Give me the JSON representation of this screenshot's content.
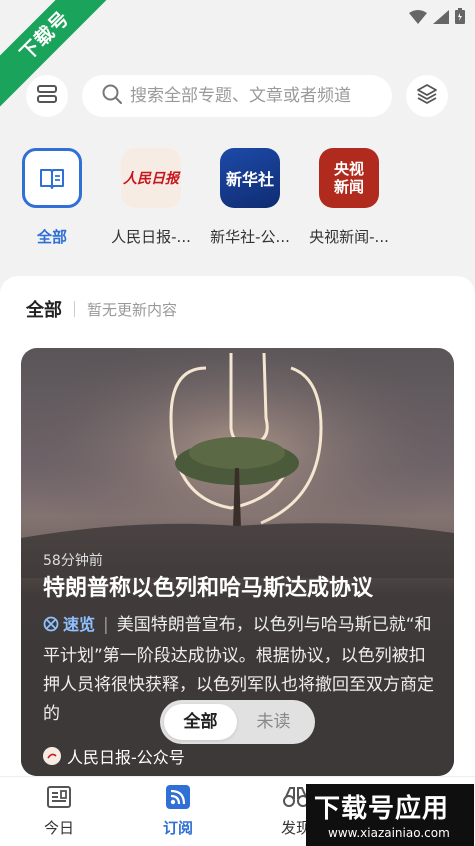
{
  "ribbon": {
    "text": "下载号"
  },
  "search": {
    "placeholder": "搜索全部专题、文章或者频道"
  },
  "channels": [
    {
      "label": "全部",
      "logo_text": ""
    },
    {
      "label": "人民日报-...",
      "logo_text": "人民日报"
    },
    {
      "label": "新华社-公...",
      "logo_text": "新华社"
    },
    {
      "label": "央视新闻-...",
      "logo_text": "央视新闻"
    }
  ],
  "panel": {
    "title": "全部",
    "subtitle": "暂无更新内容"
  },
  "card": {
    "time": "58分钟前",
    "title": "特朗普称以色列和哈马斯达成协议",
    "quick_label": "速览",
    "body": "美国特朗普宣布，以色列与哈马斯已就“和平计划”第一阶段达成协议。根据协议，以色列被扣押人员将很快获释，以色列军队也将撤回至双方商定的",
    "source": "人民日报-公众号"
  },
  "filter": {
    "options": [
      "全部",
      "未读"
    ],
    "selected": "全部"
  },
  "nav": [
    {
      "label": "今日",
      "icon": "newspaper-icon"
    },
    {
      "label": "订阅",
      "icon": "rss-icon",
      "active": true
    },
    {
      "label": "发现",
      "icon": "binoculars-icon"
    }
  ],
  "watermark": {
    "main": "下载号应用",
    "sub": "www.xiazainiao.com"
  },
  "colors": {
    "accent": "#2f6fd6",
    "ribbon": "#1aa35a",
    "background": "#f2f2f2"
  }
}
